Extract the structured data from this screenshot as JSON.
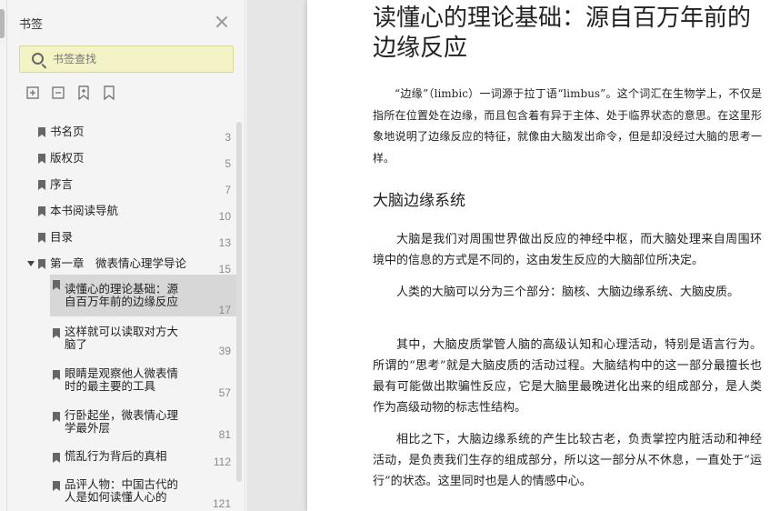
{
  "sidebar": {
    "title": "书签",
    "search_placeholder": "书签查找",
    "toolbar": [
      "expand-all-icon",
      "collapse-all-icon",
      "add-bookmark-icon",
      "bookmark-icon"
    ],
    "items": [
      {
        "label": "书名页",
        "page": "3"
      },
      {
        "label": "版权页",
        "page": "5"
      },
      {
        "label": "序言",
        "page": "7"
      },
      {
        "label": "本书阅读导航",
        "page": "10"
      },
      {
        "label": "目录",
        "page": "13"
      },
      {
        "label": "第一章　微表情心理学导论",
        "page": "15"
      },
      {
        "label": "读懂心的理论基础：源自百万年前的边缘反应",
        "label_l1": "读懂心的理论基础：源",
        "label_l2": "自百万年前的边缘反应",
        "page": "17"
      },
      {
        "label_l1": "这样就可以读取对方大",
        "label_l2": "脑了",
        "page": "39"
      },
      {
        "label_l1": "眼睛是观察他人微表情",
        "label_l2": "时的最主要的工具",
        "page": "57"
      },
      {
        "label_l1": "行卧起坐，微表情心理",
        "label_l2": "学最外层",
        "page": "81"
      },
      {
        "label": "慌乱行为背后的真相",
        "page": "112"
      },
      {
        "label_l1": "品评人物：中国古代的",
        "label_l2": "人是如何读懂人心的",
        "page": "121"
      }
    ]
  },
  "document": {
    "title": "读懂心的理论基础：源自百万年前的边缘反应",
    "intro": "“边缘”（limbic）一词源于拉丁语“limbus”。这个词汇在生物学上，不仅是指所在位置处在边缘，而且包含着有异于主体、处于临界状态的意思。在这里形象地说明了边缘反应的特征，就像由大脑发出命令，但是却没经过大脑的思考一样。",
    "section_title": "大脑边缘系统",
    "paragraphs": [
      "大脑是我们对周围世界做出反应的神经中枢，而大脑处理来自周围环境中的信息的方式是不同的，这由发生反应的大脑部位所决定。",
      "人类的大脑可以分为三个部分：脑核、大脑边缘系统、大脑皮质。",
      "其中，大脑皮质掌管人脑的高级认知和心理活动，特别是语言行为。所谓的“思考”就是大脑皮质的活动过程。大脑结构中的这一部分最擅长也最有可能做出欺骗性反应，它是大脑里最晚进化出来的组成部分，是人类作为高级动物的标志性结构。",
      "相比之下，大脑边缘系统的产生比较古老，负责掌控内脏活动和神经活动，是负责我们生存的组成部分，所以这一部分从不休息，一直处于“运行”的状态。这里同时也是人的情感中心。"
    ]
  }
}
